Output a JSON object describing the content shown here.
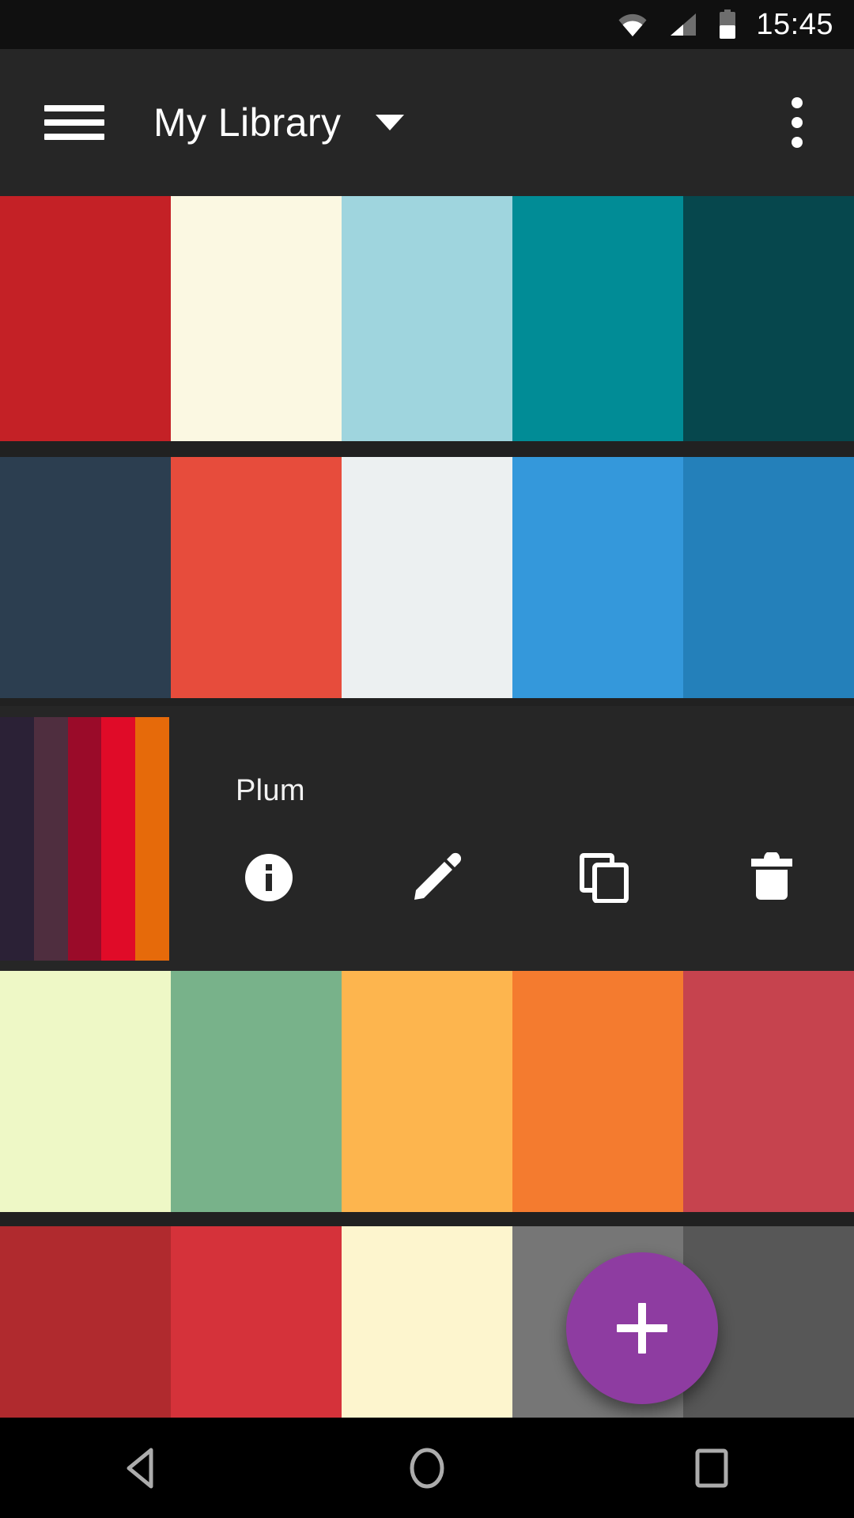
{
  "status_bar": {
    "time": "15:45",
    "icons": [
      "wifi-icon",
      "cellular-signal-icon",
      "battery-icon"
    ],
    "battery_level_pct": 50,
    "background_color": "#101010"
  },
  "app_bar": {
    "title": "My Library",
    "menu_icon": "hamburger-menu-icon",
    "dropdown_icon": "chevron-down-icon",
    "overflow_icon": "more-vertical-icon",
    "background_color": "#262626",
    "text_color": "#FFFFFF"
  },
  "palettes": [
    {
      "name": "",
      "selected": false,
      "colors": [
        "#C42126",
        "#FBF8E2",
        "#9FD5DE",
        "#018C96",
        "#06474D"
      ]
    },
    {
      "name": "",
      "selected": false,
      "colors": [
        "#2C3E50",
        "#E74C3C",
        "#ECF0F1",
        "#3498DB",
        "#2480BA"
      ]
    },
    {
      "name": "Plum",
      "selected": true,
      "colors": [
        "#2B2136",
        "#4F2E3F",
        "#9A0B29",
        "#E00B28",
        "#E66A0A"
      ],
      "actions": [
        {
          "label": "Info",
          "icon": "info-icon"
        },
        {
          "label": "Edit",
          "icon": "pencil-icon"
        },
        {
          "label": "Duplicate",
          "icon": "copy-icon"
        },
        {
          "label": "Delete",
          "icon": "trash-icon"
        }
      ]
    },
    {
      "name": "",
      "selected": false,
      "colors": [
        "#EEF8C6",
        "#78B28A",
        "#FDB54E",
        "#F47B2F",
        "#C6434E"
      ]
    },
    {
      "name": "",
      "selected": false,
      "colors": [
        "#B02A2E",
        "#D5323A",
        "#FDF5CE",
        "#767676",
        "#575757"
      ]
    }
  ],
  "fab": {
    "icon": "plus-icon",
    "label": "Add palette",
    "color": "#8E3CA1",
    "icon_color": "#FFFFFF"
  },
  "nav_bar": {
    "back": {
      "label": "Back",
      "icon": "triangle-back-icon"
    },
    "home": {
      "label": "Home",
      "icon": "circle-home-icon"
    },
    "recents": {
      "label": "Recents",
      "icon": "square-recents-icon"
    },
    "background_color": "#000000",
    "icon_color": "#ACACAC"
  }
}
